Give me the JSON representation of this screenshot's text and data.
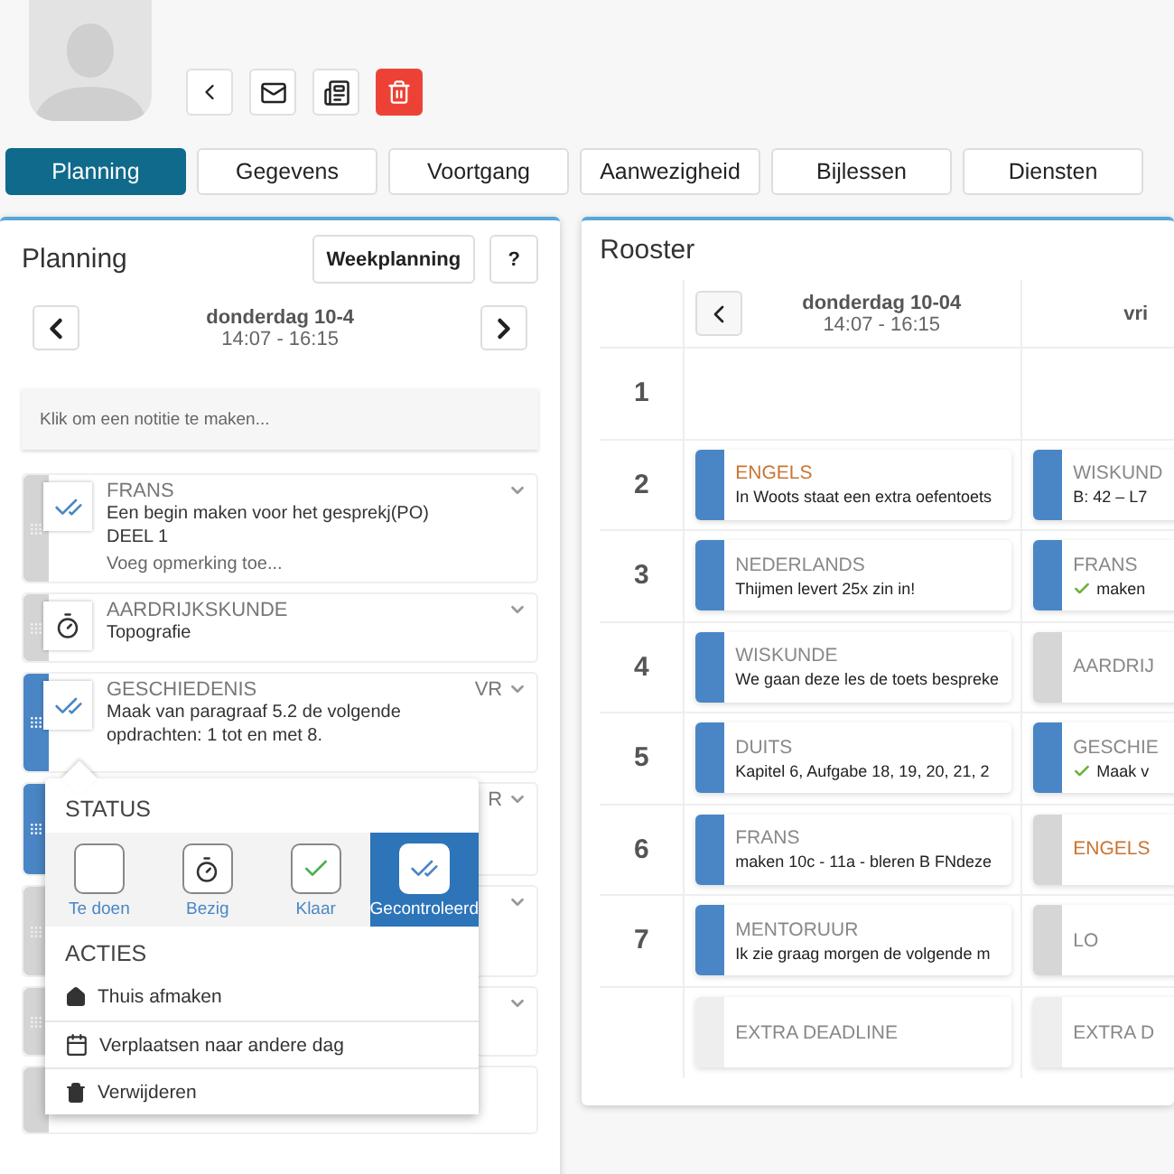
{
  "toolbar": {
    "buttons": [
      {
        "kind": "back"
      },
      {
        "kind": "mail"
      },
      {
        "kind": "docs"
      },
      {
        "kind": "delete"
      }
    ]
  },
  "tabs": [
    {
      "label": "Planning",
      "selected": true
    },
    {
      "label": "Gegevens",
      "selected": false
    },
    {
      "label": "Voortgang",
      "selected": false
    },
    {
      "label": "Aanwezigheid",
      "selected": false
    },
    {
      "label": "Bijlessen",
      "selected": false
    },
    {
      "label": "Diensten",
      "selected": false
    }
  ],
  "planning": {
    "title": "Planning",
    "buttons": [
      "Weekplanning",
      "?"
    ],
    "day": "donderdag 10-4",
    "time": "14:07 - 16:15",
    "note": {
      "placeholder": "Klik om een notitie te maken..."
    },
    "tasks": [
      {
        "subject": "FRANS",
        "description": "Een begin maken voor het gesprekj(PO)\nDEEL 1",
        "comment": "Voeg opmerking toe...",
        "kind": "checked",
        "selected": false
      },
      {
        "subject": "AARDRIJKSKUNDE",
        "description": "Topografie",
        "kind": "busy",
        "selected": false
      },
      {
        "subject": "GESCHIEDENIS",
        "tag": "VR",
        "description": "Maak van paragraaf 5.2 de volgende opdrachten: 1 tot en met 8.",
        "kind": "checked",
        "selected": true
      },
      {
        "tag": "R",
        "selected": true
      },
      {
        "selected": false
      },
      {
        "selected": false
      }
    ],
    "popup": {
      "status_title": "STATUS",
      "options": [
        {
          "label": "Te doen",
          "kind": "todo",
          "selected": false
        },
        {
          "label": "Bezig",
          "kind": "busy",
          "selected": false
        },
        {
          "label": "Klaar",
          "kind": "done",
          "selected": false
        },
        {
          "label": "Gecontroleerd",
          "kind": "checked",
          "selected": true
        }
      ],
      "actions_title": "ACTIES",
      "actions": [
        {
          "label": "Thuis afmaken",
          "kind": "home"
        },
        {
          "label": "Verplaatsen naar andere dag",
          "kind": "calendar"
        },
        {
          "label": "Verwijderen",
          "kind": "delete"
        }
      ]
    }
  },
  "rooster": {
    "title": "Rooster",
    "days": [
      {
        "label": "donderdag 10-04",
        "time": "14:07 - 16:15"
      },
      {
        "label": "vri"
      }
    ],
    "periods": [
      {
        "number": "1",
        "cells": [
          null,
          null
        ]
      },
      {
        "number": "2",
        "cells": [
          {
            "subject": "ENGELS",
            "flagged": true,
            "note": "In Woots staat een extra oefentoets",
            "kind": "planned"
          },
          {
            "subject": "WISKUND",
            "note": "B: 42 – L7",
            "kind": "planned"
          }
        ]
      },
      {
        "number": "3",
        "cells": [
          {
            "subject": "NEDERLANDS",
            "note": "Thijmen levert 25x zin in!",
            "kind": "planned"
          },
          {
            "subject": "FRANS",
            "note": "maken",
            "done": true,
            "kind": "planned"
          }
        ]
      },
      {
        "number": "4",
        "cells": [
          {
            "subject": "WISKUNDE",
            "note": "We gaan deze les de toets bespreke",
            "kind": "planned"
          },
          {
            "subject": "AARDRIJ",
            "kind": "none"
          }
        ]
      },
      {
        "number": "5",
        "cells": [
          {
            "subject": "DUITS",
            "note": "Kapitel 6, Aufgabe 18, 19, 20, 21, 2",
            "kind": "planned"
          },
          {
            "subject": "GESCHIE",
            "note": "Maak v",
            "done": true,
            "kind": "planned"
          }
        ]
      },
      {
        "number": "6",
        "cells": [
          {
            "subject": "FRANS",
            "note": "maken 10c - 11a - bleren B FNdeze",
            "kind": "planned"
          },
          {
            "subject": "ENGELS",
            "flagged": true,
            "kind": "none"
          }
        ]
      },
      {
        "number": "7",
        "cells": [
          {
            "subject": "MENTORUUR",
            "note": "Ik zie graag morgen de volgende m",
            "kind": "planned"
          },
          {
            "subject": "LO",
            "kind": "none"
          }
        ]
      },
      {
        "cells": [
          {
            "subject": "EXTRA DEADLINE",
            "kind": "deadline"
          },
          {
            "subject": "EXTRA D",
            "kind": "deadline"
          }
        ]
      }
    ]
  }
}
